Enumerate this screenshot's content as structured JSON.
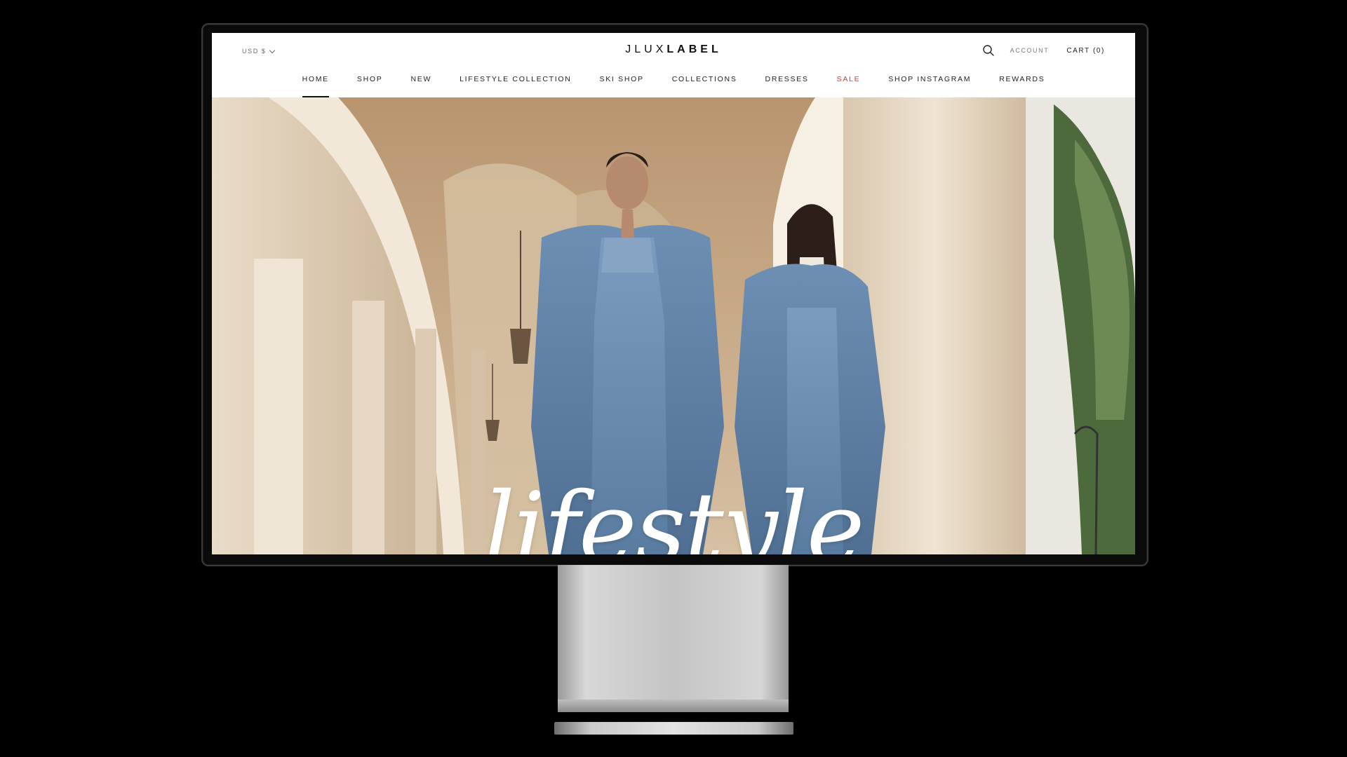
{
  "header": {
    "currency": "USD $",
    "logo_part1": "JLUX",
    "logo_part2": "LABEL",
    "account": "ACCOUNT",
    "cart": "CART (0)"
  },
  "nav": {
    "items": [
      {
        "label": "HOME",
        "active": true
      },
      {
        "label": "SHOP"
      },
      {
        "label": "NEW"
      },
      {
        "label": "LIFESTYLE COLLECTION"
      },
      {
        "label": "SKI SHOP"
      },
      {
        "label": "COLLECTIONS"
      },
      {
        "label": "DRESSES"
      },
      {
        "label": "SALE",
        "accent": "#d0402d"
      },
      {
        "label": "SHOP INSTAGRAM"
      },
      {
        "label": "REWARDS"
      }
    ]
  },
  "hero": {
    "title": "lifestyle",
    "image": "two-models-in-denim-coats-under-arcade"
  },
  "icons": {
    "search": "search-icon",
    "currency_dropdown": "chevron-down-icon"
  }
}
